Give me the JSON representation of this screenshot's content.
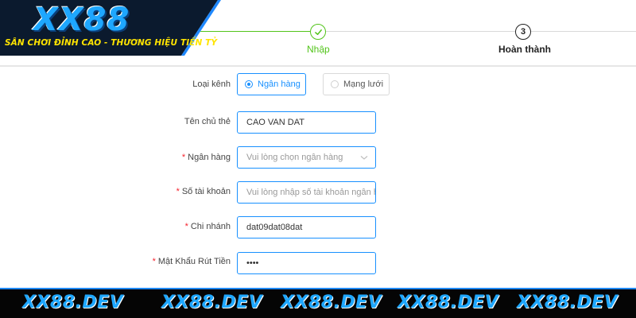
{
  "brand": {
    "logo_text": "XX88",
    "tagline": "SÂN CHƠI ĐỈNH CAO - THƯƠNG HIỆU TIỀN TỶ",
    "colors": {
      "logo_blue": "#1ea7ff",
      "tagline_yellow": "#ffe400",
      "banner_dark": "#0b1a2e"
    }
  },
  "stepper": {
    "steps": [
      {
        "label": "Nhập",
        "state": "done",
        "icon": "check-icon"
      },
      {
        "label": "Hoàn thành",
        "state": "current",
        "number": "3"
      }
    ],
    "colors": {
      "done": "#52c41a",
      "current": "#222222"
    }
  },
  "form": {
    "channel": {
      "label": "Loại kênh",
      "options": [
        {
          "label": "Ngân hàng",
          "selected": true
        },
        {
          "label": "Mạng lưới",
          "selected": false
        }
      ]
    },
    "account_holder": {
      "label": "Tên chủ thẻ",
      "value": "CAO VAN DAT",
      "required": false
    },
    "bank": {
      "label": "Ngân hàng",
      "placeholder": "Vui lòng chọn ngân hàng",
      "required": true,
      "icon": "chevron-down-icon"
    },
    "account_number": {
      "label": "Số tài khoản",
      "placeholder": "Vui lòng nhập số tài khoản ngân hà",
      "required": true
    },
    "branch": {
      "label": "Chi nhánh",
      "value": "dat09dat08dat",
      "required": true
    },
    "withdraw_password": {
      "label": "Mật Khẩu Rút Tiền",
      "value": "••••",
      "required": true
    },
    "required_mark": "*",
    "colors": {
      "accent": "#1890ff",
      "required": "#f5222d"
    }
  },
  "watermark": {
    "items": [
      "XX88.DEV",
      "XX88.DEV",
      "XX88.DEV",
      "XX88.DEV",
      "XX88.DEV"
    ],
    "colors": {
      "bar": "#050505",
      "text": "#1ea7ff"
    }
  }
}
